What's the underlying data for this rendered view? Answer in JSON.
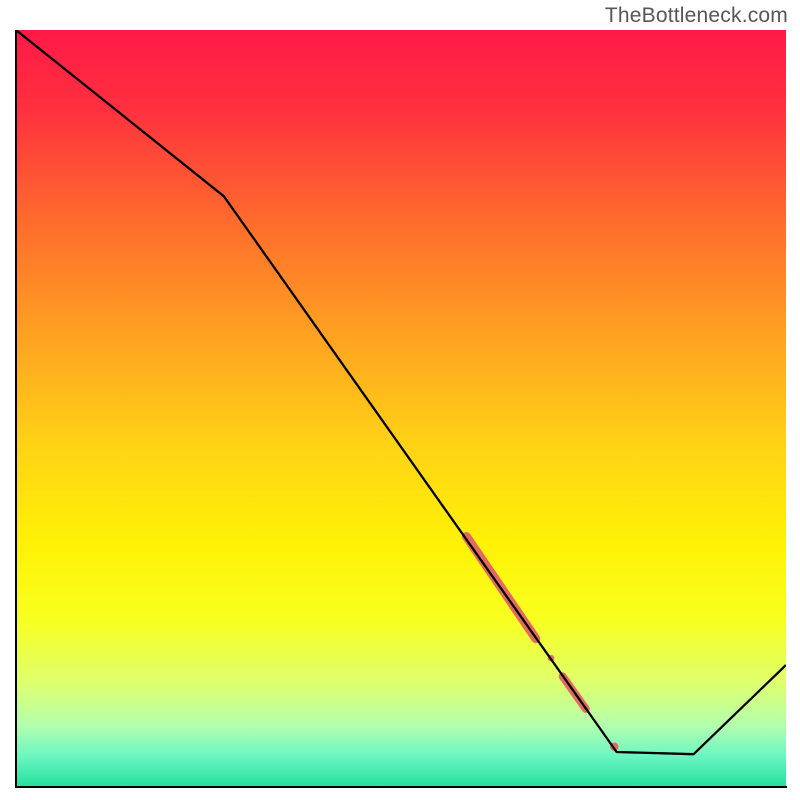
{
  "watermark": "TheBottleneck.com",
  "chart_data": {
    "type": "line",
    "title": "",
    "xlabel": "",
    "ylabel": "",
    "xlim": [
      0,
      100
    ],
    "ylim": [
      0,
      100
    ],
    "gradient_stops": [
      {
        "offset": 0.0,
        "color": "#ff1a47"
      },
      {
        "offset": 0.1,
        "color": "#ff2f3f"
      },
      {
        "offset": 0.25,
        "color": "#ff6a2d"
      },
      {
        "offset": 0.4,
        "color": "#ffa021"
      },
      {
        "offset": 0.55,
        "color": "#ffd316"
      },
      {
        "offset": 0.68,
        "color": "#fff205"
      },
      {
        "offset": 0.78,
        "color": "#f8ff20"
      },
      {
        "offset": 0.86,
        "color": "#e0ff6a"
      },
      {
        "offset": 0.92,
        "color": "#b3ffad"
      },
      {
        "offset": 0.96,
        "color": "#6cf6c2"
      },
      {
        "offset": 1.0,
        "color": "#25e19e"
      }
    ],
    "series": [
      {
        "name": "bottleneck-curve",
        "stroke": "#000000",
        "stroke_width": 2.3,
        "points": [
          {
            "x": 0,
            "y": 100
          },
          {
            "x": 27,
            "y": 78
          },
          {
            "x": 78,
            "y": 4.5
          },
          {
            "x": 88,
            "y": 4.2
          },
          {
            "x": 100,
            "y": 16
          }
        ]
      }
    ],
    "markers": [
      {
        "name": "thick-segment-1",
        "color": "#e26a61",
        "x1": 58.5,
        "y1": 33.0,
        "x2": 67.5,
        "y2": 19.5,
        "width": 9
      },
      {
        "name": "dot-1",
        "color": "#e26a61",
        "cx": 69.5,
        "cy": 16.9,
        "r": 3.3
      },
      {
        "name": "thick-segment-2",
        "color": "#e26a61",
        "x1": 71.0,
        "y1": 14.5,
        "x2": 74.0,
        "y2": 10.2,
        "width": 8
      },
      {
        "name": "dot-2",
        "color": "#e26a61",
        "cx": 77.7,
        "cy": 5.2,
        "r": 4.2
      }
    ]
  }
}
